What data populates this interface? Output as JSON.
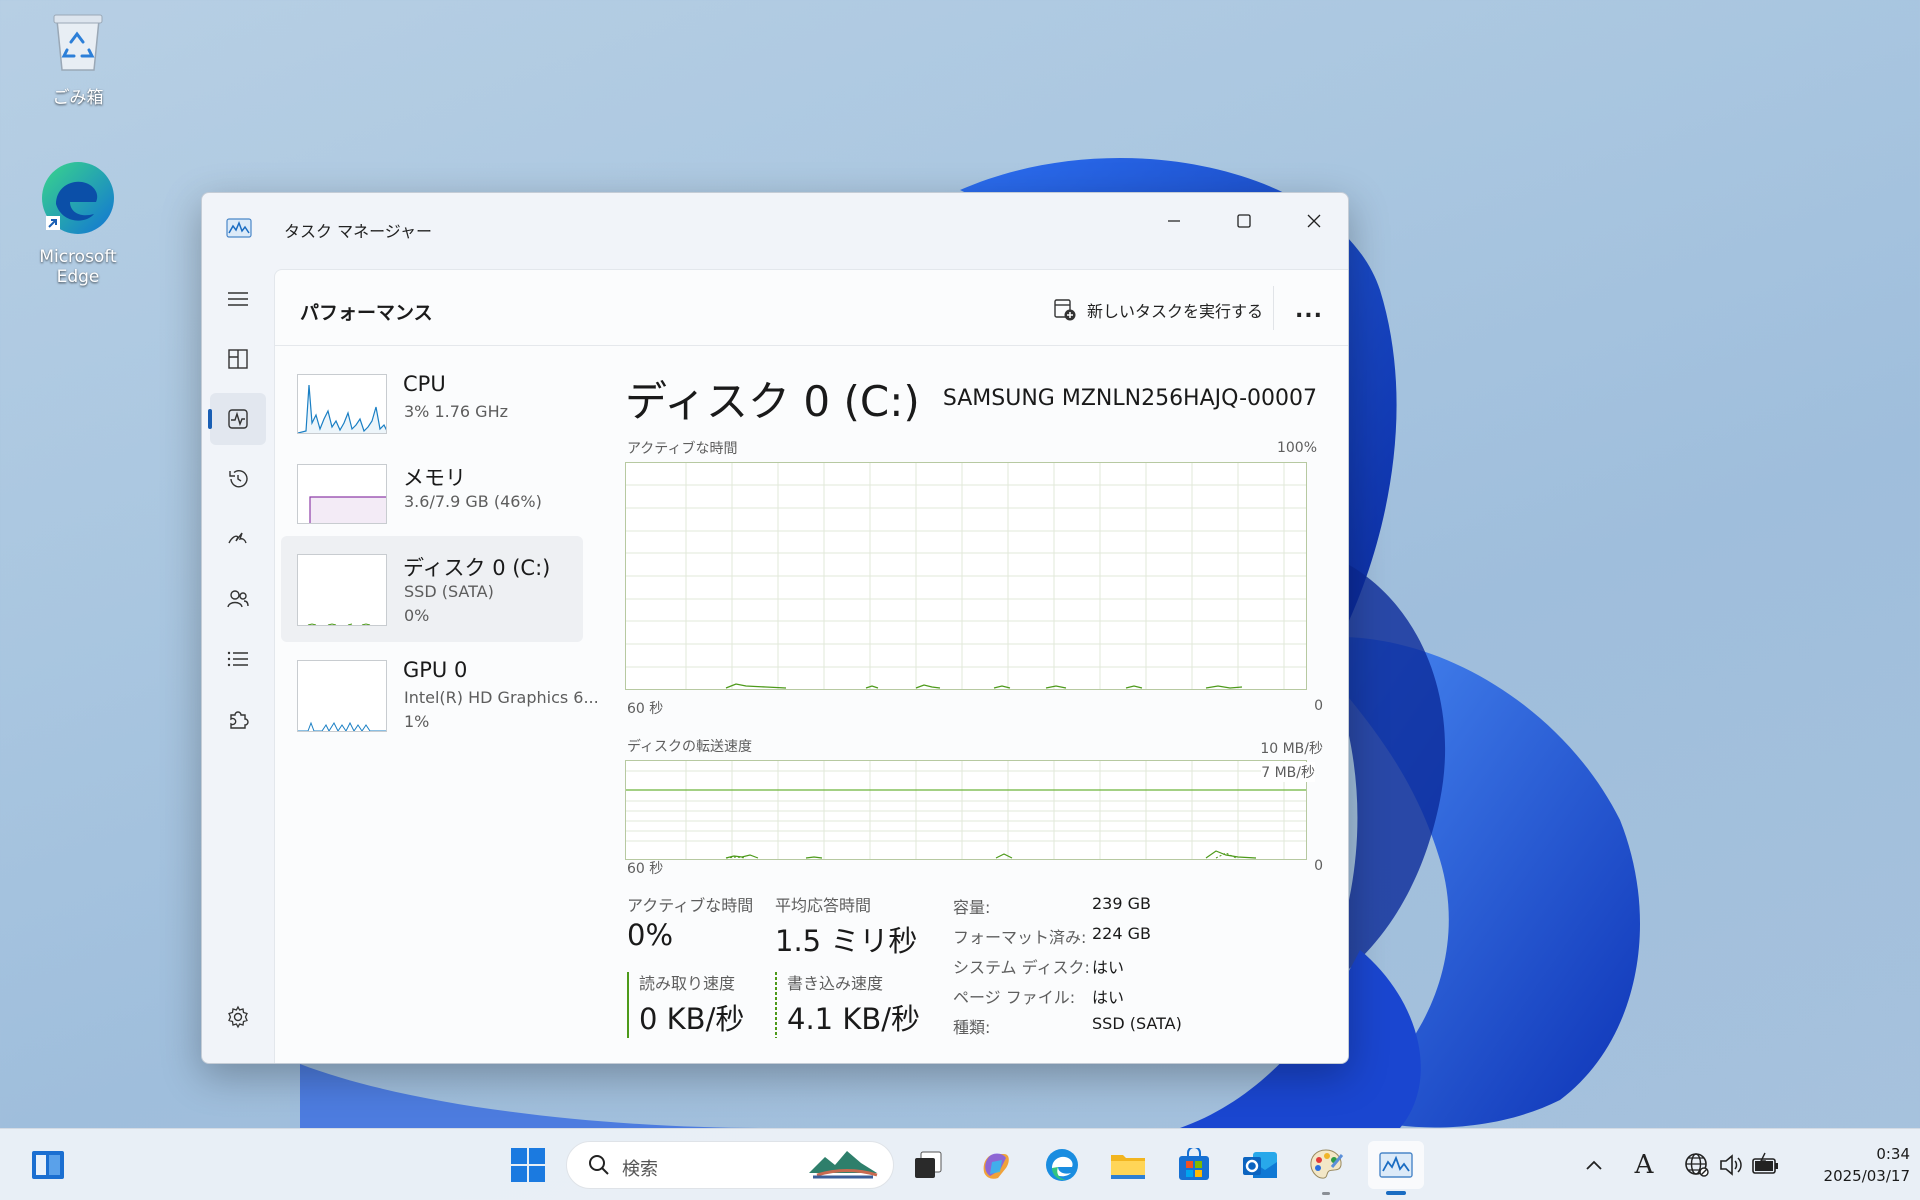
{
  "desktop": {
    "icons": [
      {
        "label": "ごみ箱",
        "icon": "recycle-bin-icon"
      },
      {
        "label": "Microsoft Edge",
        "icon": "edge-icon"
      }
    ]
  },
  "window": {
    "title": "タスク マネージャー",
    "page_title": "パフォーマンス",
    "run_task_label": "新しいタスクを実行する",
    "more_label": "...",
    "devices": [
      {
        "name": "CPU",
        "line1": "3%  1.76 GHz",
        "line2": "",
        "color": "#1a7fc4"
      },
      {
        "name": "メモリ",
        "line1": "3.6/7.9 GB (46%)",
        "line2": "",
        "color": "#8e3ea8"
      },
      {
        "name": "ディスク 0 (C:)",
        "line1": "SSD (SATA)",
        "line2": "0%",
        "color": "#4d9a1a"
      },
      {
        "name": "GPU 0",
        "line1": "Intel(R) HD Graphics 6...",
        "line2": "1%",
        "color": "#1a7fc4"
      }
    ],
    "detail": {
      "title": "ディスク 0 (C:)",
      "model": "SAMSUNG MZNLN256HAJQ-00007",
      "graph1": {
        "label": "アクティブな時間",
        "max": "100%",
        "x_left": "60 秒",
        "x_right": "0"
      },
      "graph2": {
        "label": "ディスクの転送速度",
        "max": "10 MB/秒",
        "line_label": "7 MB/秒",
        "x_left": "60 秒",
        "x_right": "0"
      },
      "stats": {
        "active_label": "アクティブな時間",
        "active_value": "0%",
        "resp_label": "平均応答時間",
        "resp_value": "1.5 ミリ秒",
        "read_label": "読み取り速度",
        "read_value": "0 KB/秒",
        "write_label": "書き込み速度",
        "write_value": "4.1 KB/秒"
      },
      "properties": [
        {
          "key": "容量:",
          "value": "239 GB"
        },
        {
          "key": "フォーマット済み:",
          "value": "224 GB"
        },
        {
          "key": "システム ディスク:",
          "value": "はい"
        },
        {
          "key": "ページ ファイル:",
          "value": "はい"
        },
        {
          "key": "種類:",
          "value": "SSD (SATA)"
        }
      ],
      "accent": "#4d9a1a"
    }
  },
  "taskbar": {
    "search_placeholder": "検索",
    "clock_time": "0:34",
    "clock_date": "2025/03/17",
    "ime_label": "A"
  }
}
